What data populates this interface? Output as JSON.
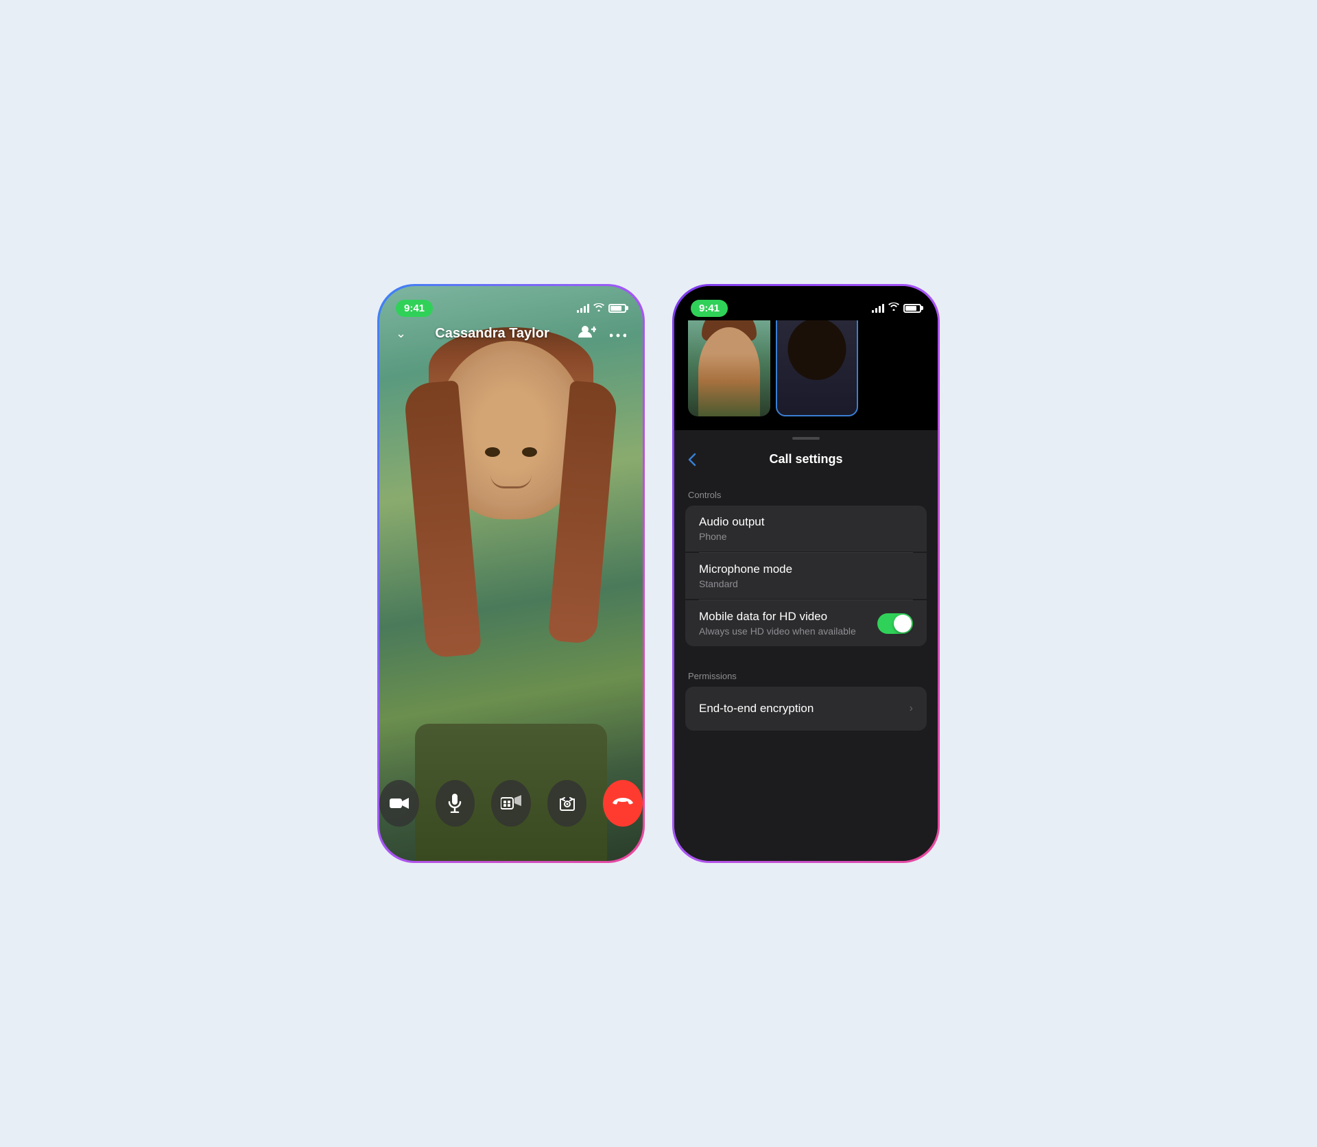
{
  "page": {
    "background": "#e8eef5"
  },
  "left_phone": {
    "status_bar": {
      "time": "9:41",
      "signal": "●●●",
      "wifi": "wifi",
      "battery": "battery"
    },
    "caller_name": "Cassandra Taylor",
    "controls": [
      {
        "id": "video",
        "icon": "🎥",
        "label": "video-button"
      },
      {
        "id": "mic",
        "icon": "🎤",
        "label": "microphone-button"
      },
      {
        "id": "games",
        "icon": "🎮",
        "label": "effects-button"
      },
      {
        "id": "flip",
        "icon": "📷",
        "label": "flip-camera-button"
      },
      {
        "id": "end",
        "icon": "📵",
        "label": "end-call-button"
      }
    ]
  },
  "right_phone": {
    "status_bar": {
      "time": "9:41"
    },
    "settings_title": "Call settings",
    "back_label": "‹",
    "sections": {
      "controls": {
        "label": "Controls",
        "rows": [
          {
            "id": "audio_output",
            "title": "Audio output",
            "subtitle": "Phone",
            "has_toggle": false,
            "has_chevron": false
          },
          {
            "id": "microphone_mode",
            "title": "Microphone mode",
            "subtitle": "Standard",
            "has_toggle": false,
            "has_chevron": false
          },
          {
            "id": "mobile_data_hd",
            "title": "Mobile data for HD video",
            "subtitle": "Always use HD video when available",
            "has_toggle": true,
            "toggle_on": true,
            "has_chevron": false
          }
        ]
      },
      "permissions": {
        "label": "Permissions",
        "rows": [
          {
            "id": "end_to_end",
            "title": "End-to-end encryption",
            "subtitle": "",
            "has_toggle": false,
            "has_chevron": true
          }
        ]
      }
    }
  }
}
